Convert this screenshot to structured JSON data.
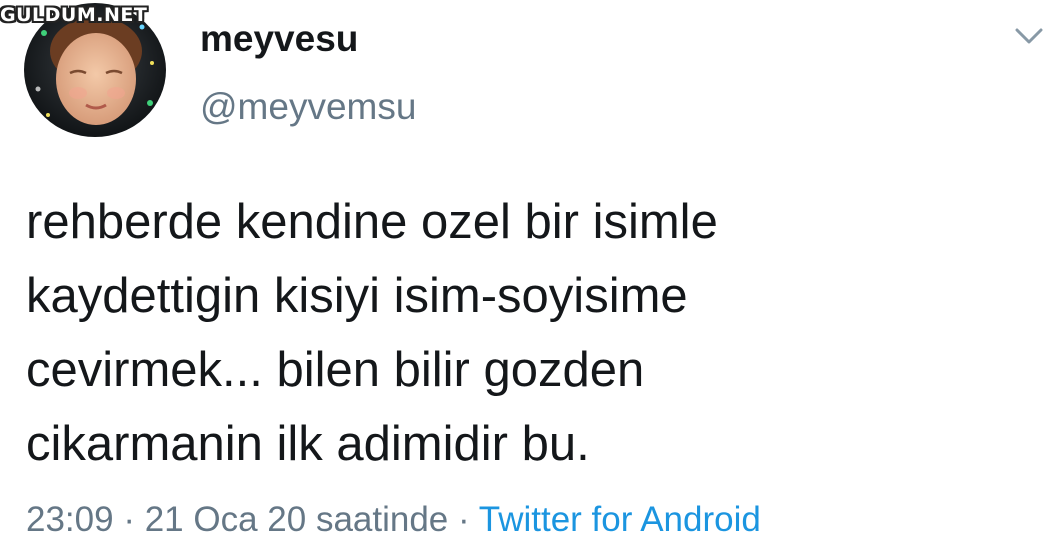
{
  "watermark": "GULDUM.NET",
  "user": {
    "display_name": "meyvesu",
    "handle": "@meyvemsu"
  },
  "tweet": {
    "text": "rehberde kendine ozel bir isimle\nkaydettigin kisiyi isim-soyisime\ncevirmek... bilen bilir gozden\ncikarmanin ilk adimidir bu.",
    "time": "23:09",
    "separator": "·",
    "date_text": "21 Oca 20 saatinde",
    "source": "Twitter for Android"
  },
  "icons": {
    "menu": "chevron-down-icon"
  },
  "colors": {
    "text_primary": "#14171a",
    "text_secondary": "#657786",
    "link": "#1b95e0",
    "background": "#ffffff"
  }
}
